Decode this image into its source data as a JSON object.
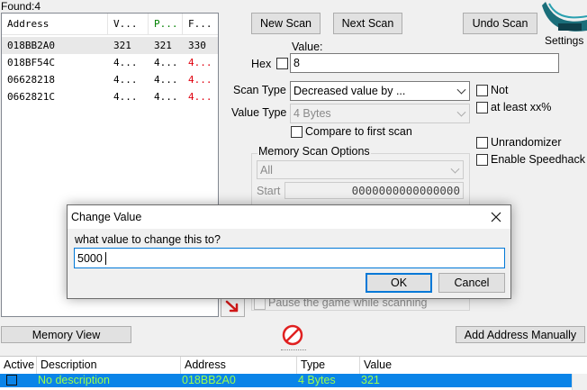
{
  "status": {
    "found": "Found:4"
  },
  "address_list": {
    "headers": {
      "address": "Address",
      "value": "V...",
      "previous": "P...",
      "first": "F..."
    },
    "rows": [
      {
        "address": "018BB2A0",
        "value": "321",
        "previous": "321",
        "first": "330"
      },
      {
        "address": "018BF54C",
        "value": "4...",
        "previous": "4...",
        "first": "4..."
      },
      {
        "address": "06628218",
        "value": "4...",
        "previous": "4...",
        "first": "4..."
      },
      {
        "address": "0662821C",
        "value": "4...",
        "previous": "4...",
        "first": "4..."
      }
    ]
  },
  "toolbar": {
    "new_scan": "New Scan",
    "next_scan": "Next Scan",
    "undo_scan": "Undo Scan",
    "settings": "Settings"
  },
  "scan": {
    "value_label": "Value:",
    "hex_label": "Hex",
    "value": "8",
    "scan_type_label": "Scan Type",
    "scan_type": "Decreased value by ...",
    "value_type_label": "Value Type",
    "value_type": "4 Bytes",
    "compare_first": "Compare to first scan",
    "not_label": "Not",
    "at_least": "at least xx%",
    "unrandomizer": "Unrandomizer",
    "speedhack": "Enable Speedhack"
  },
  "memory_options": {
    "title": "Memory Scan Options",
    "region": "All",
    "start_label": "Start",
    "start_value": "0000000000000000",
    "pause_label": "Pause the game while scanning"
  },
  "dialog": {
    "title": "Change Value",
    "prompt": "what value to change this to?",
    "input_value": "5000",
    "ok": "OK",
    "cancel": "Cancel"
  },
  "bottom_buttons": {
    "memory_view": "Memory View",
    "add_address": "Add Address Manually"
  },
  "cheat_table": {
    "headers": {
      "active": "Active",
      "description": "Description",
      "address": "Address",
      "type": "Type",
      "value": "Value"
    },
    "rows": [
      {
        "description": "No description",
        "address": "018BB2A0",
        "type": "4 Bytes",
        "value": "321"
      }
    ]
  },
  "colors": {
    "accent": "#0078d7",
    "changed_value": "#e0000f",
    "selected_row": "#0a84e8",
    "row_text": "#9cff4a"
  }
}
